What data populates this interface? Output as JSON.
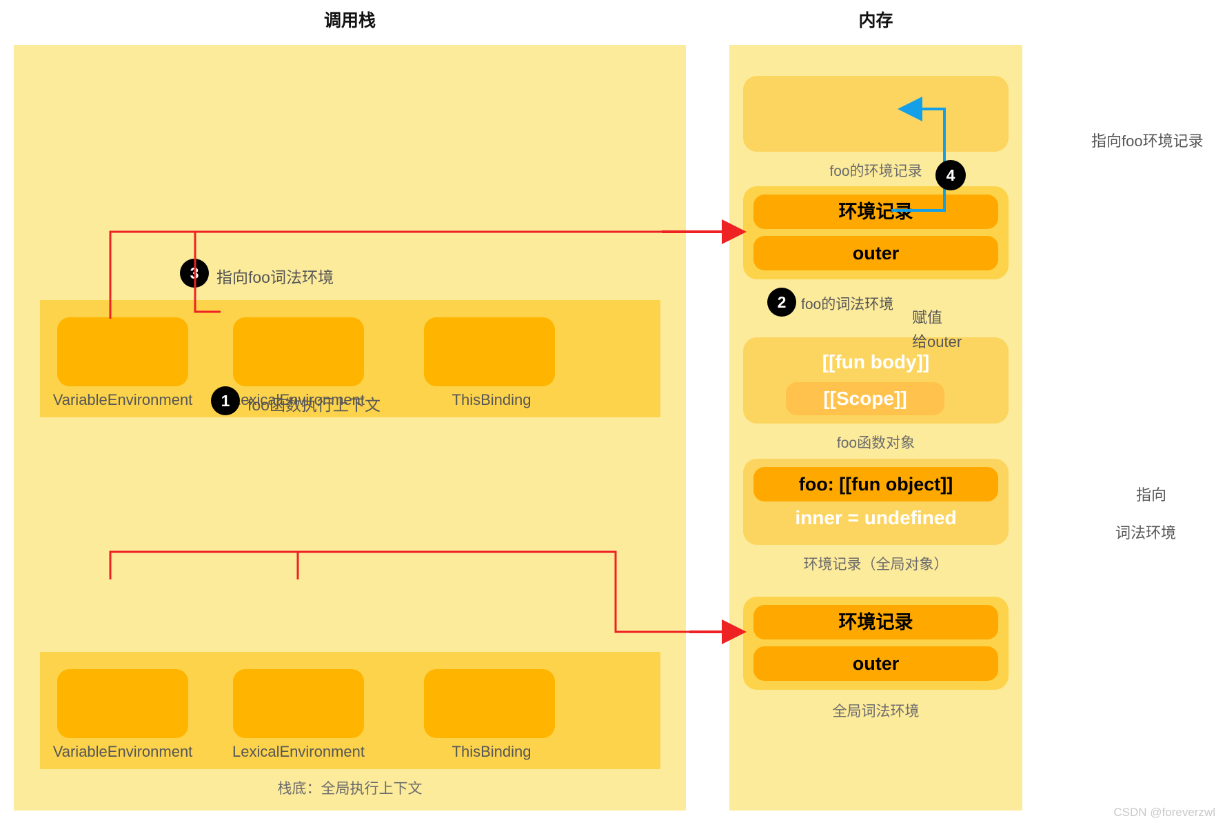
{
  "columns": {
    "callstack_title": "调用栈",
    "memory_title": "内存"
  },
  "callstack": {
    "foo_context": {
      "slots": [
        {
          "label": "VariableEnvironment"
        },
        {
          "label": "LexicalEnvironment"
        },
        {
          "label": "ThisBinding"
        }
      ],
      "badge": "1",
      "caption": "foo函数执行上下文"
    },
    "global_context": {
      "slots": [
        {
          "label": "VariableEnvironment"
        },
        {
          "label": "LexicalEnvironment"
        },
        {
          "label": "ThisBinding"
        }
      ],
      "caption": "栈底：全局执行上下文"
    },
    "annotation_3": {
      "badge": "3",
      "label": "指向foo词法环境"
    }
  },
  "memory": {
    "foo_env_record": {
      "caption": "foo的环境记录"
    },
    "foo_lexical_env": {
      "rows": [
        "环境记录",
        "outer"
      ],
      "badge": "2",
      "caption": "foo的词法环境"
    },
    "foo_function_object": {
      "fun_body": "[[fun body]]",
      "scope": "[[Scope]]",
      "caption": "foo函数对象"
    },
    "global_env_record": {
      "row": "foo: [[fun object]]",
      "text": "inner = undefined",
      "caption": "环境记录（全局对象）"
    },
    "global_lexical_env": {
      "rows": [
        "环境记录",
        "outer"
      ],
      "caption": "全局词法环境"
    }
  },
  "annotations": {
    "arrow_4": {
      "badge": "4",
      "label": "指向foo环境记录"
    },
    "assign_outer": {
      "line1": "赋值",
      "line2": "给outer"
    },
    "point_lexical": {
      "line1": "指向",
      "line2": "词法环境"
    }
  },
  "watermark": "CSDN @foreverzwl",
  "colors": {
    "panel_bg": "#fdeb9c",
    "card_bg": "#fcd34b",
    "slot": "#ffb400",
    "row": "#ffa800",
    "red_arrow": "#ee2222",
    "blue_arrow": "#14a0e8",
    "orange_arrow": "#f2a81d",
    "badge": "#000000",
    "text_gray": "#565656"
  }
}
